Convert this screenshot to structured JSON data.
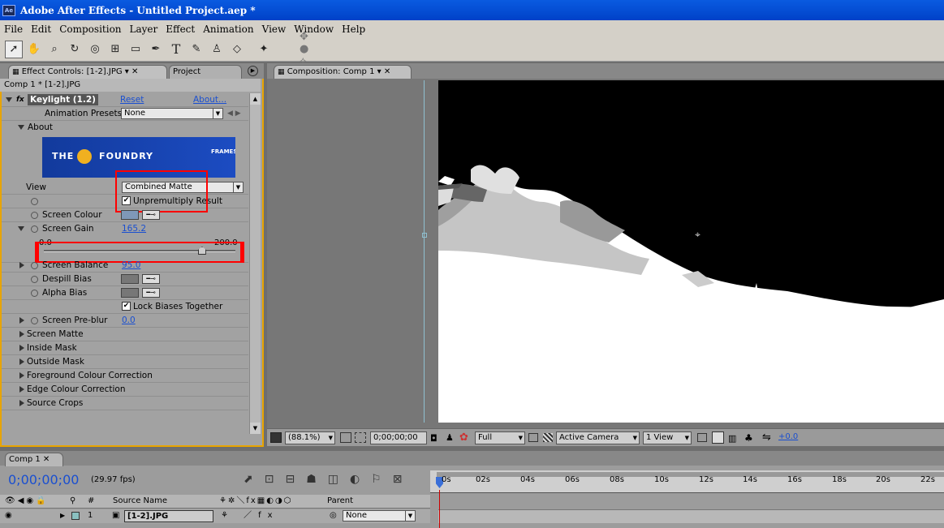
{
  "window": {
    "title": "Adobe After Effects - Untitled Project.aep *",
    "app_icon": "Ae"
  },
  "menu": [
    "File",
    "Edit",
    "Composition",
    "Layer",
    "Effect",
    "Animation",
    "View",
    "Window",
    "Help"
  ],
  "tools": [
    "selection-tool",
    "hand-tool",
    "zoom-tool",
    "rotate-tool",
    "orbit-camera-tool",
    "track-xy-camera-tool",
    "rectangle-mask-tool",
    "pen-tool",
    "text-tool",
    "brush-tool",
    "clone-stamp-tool",
    "eraser-tool",
    "puppet-pin-tool"
  ],
  "left_panel": {
    "tab_effect": "Effect Controls: [1-2].JPG",
    "tab_project": "Project",
    "comp_path": "Comp 1 * [1-2].JPG",
    "effect_name": "Keylight (1.2)",
    "reset": "Reset",
    "about_link": "About...",
    "presets_label": "Animation Presets:",
    "presets_value": "None",
    "about": "About",
    "logo_text": "THE FOUNDRY",
    "logo_sub": "FRAMES",
    "view_label": "View",
    "view_value": "Combined Matte",
    "unpremultiply": "Unpremultiply Result",
    "screen_colour": "Screen Colour",
    "screen_gain": "Screen Gain",
    "screen_gain_value": "165.2",
    "slider_min": "0.0",
    "slider_max": "200.0",
    "slider_level": 0.826,
    "screen_balance": "Screen Balance",
    "screen_balance_value": "95.0",
    "despill_bias": "Despill Bias",
    "alpha_bias": "Alpha Bias",
    "lock_biases": "Lock Biases Together",
    "screen_preblur": "Screen Pre-blur",
    "screen_preblur_value": "0.0",
    "groups": [
      "Screen Matte",
      "Inside Mask",
      "Outside Mask",
      "Foreground Colour Correction",
      "Edge Colour Correction",
      "Source Crops"
    ]
  },
  "composition": {
    "tab": "Composition: Comp 1",
    "zoom": "(88.1%)",
    "timecode": "0;00;00;00",
    "resolution": "Full",
    "camera": "Active Camera",
    "views": "1 View",
    "exposure": "+0.0"
  },
  "timeline": {
    "tab": "Comp 1",
    "timecode": "0;00;00;00",
    "fps": "(29.97 fps)",
    "col_source": "Source Name",
    "col_parent": "Parent",
    "layer_num": "1",
    "layer_name": "[1-2].JPG",
    "parent_value": "None",
    "ruler": [
      "0s",
      "02s",
      "04s",
      "06s",
      "08s",
      "10s",
      "12s",
      "14s",
      "16s",
      "18s",
      "20s",
      "22s"
    ]
  },
  "colors": {
    "title_bar": "#0050d8",
    "panel_highlight": "#e8a400",
    "annotation": "#ff0000",
    "timecode": "#1a4fd0"
  }
}
